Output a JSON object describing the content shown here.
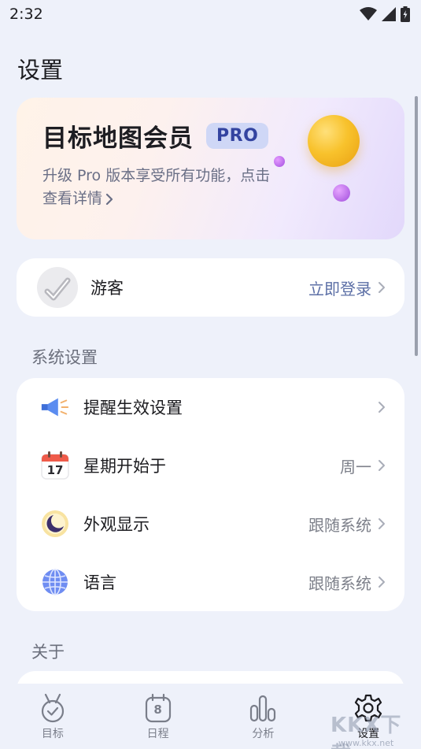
{
  "status_bar": {
    "time": "2:32"
  },
  "page": {
    "title": "设置"
  },
  "pro_card": {
    "title": "目标地图会员",
    "badge": "PRO",
    "desc_line1": "升级 Pro 版本享受所有功能，点击",
    "desc_line2": "查看详情"
  },
  "guest": {
    "name": "游客",
    "login_label": "立即登录"
  },
  "sections": {
    "system": "系统设置",
    "about": "关于"
  },
  "settings": {
    "items": [
      {
        "label": "提醒生效设置",
        "value": ""
      },
      {
        "label": "星期开始于",
        "value": "周一",
        "calendar_day": "17"
      },
      {
        "label": "外观显示",
        "value": "跟随系统"
      },
      {
        "label": "语言",
        "value": "跟随系统"
      }
    ]
  },
  "nav": {
    "items": [
      {
        "label": "目标"
      },
      {
        "label": "日程",
        "day": "8"
      },
      {
        "label": "分析"
      },
      {
        "label": "设置"
      }
    ]
  },
  "watermark": {
    "text": "KKX下载",
    "url": "www.kkx.net"
  },
  "colors": {
    "accent": "#5c6fa6",
    "background": "#eef1fa",
    "badge_bg": "#cfd7f6"
  }
}
